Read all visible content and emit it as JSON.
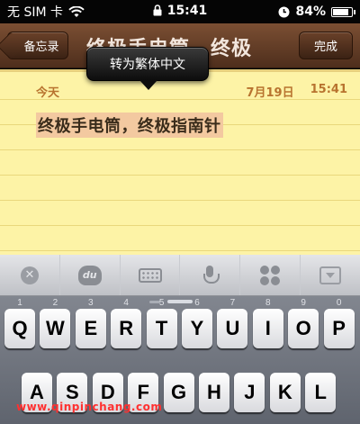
{
  "status": {
    "carrier": "无 SIM 卡",
    "time": "15:41",
    "battery": "84%",
    "battery_level": 0.84
  },
  "nav": {
    "back_label": "备忘录",
    "title": "终极手电筒，终极",
    "done_label": "完成"
  },
  "tooltip": {
    "label": "转为繁体中文"
  },
  "note": {
    "today_label": "今天",
    "date": "7月19日",
    "time": "15:41",
    "text": "终极手电筒，终极指南针"
  },
  "keyboard": {
    "toolbar_icons": [
      "clear-icon",
      "du-icon",
      "keyboard-icon",
      "microphone-icon",
      "clover-icon",
      "hide-keyboard-icon"
    ],
    "clear_glyph": "✕",
    "du_glyph": "du",
    "row1": [
      {
        "key": "Q",
        "num": "1"
      },
      {
        "key": "W",
        "num": "2"
      },
      {
        "key": "E",
        "num": "3"
      },
      {
        "key": "R",
        "num": "4"
      },
      {
        "key": "T",
        "num": "5"
      },
      {
        "key": "Y",
        "num": "6"
      },
      {
        "key": "U",
        "num": "7"
      },
      {
        "key": "I",
        "num": "8"
      },
      {
        "key": "O",
        "num": "9"
      },
      {
        "key": "P",
        "num": "0"
      }
    ],
    "row2": [
      "A",
      "S",
      "D",
      "F",
      "G",
      "H",
      "J",
      "K",
      "L"
    ]
  },
  "watermark": "www.qinpinchang.com"
}
